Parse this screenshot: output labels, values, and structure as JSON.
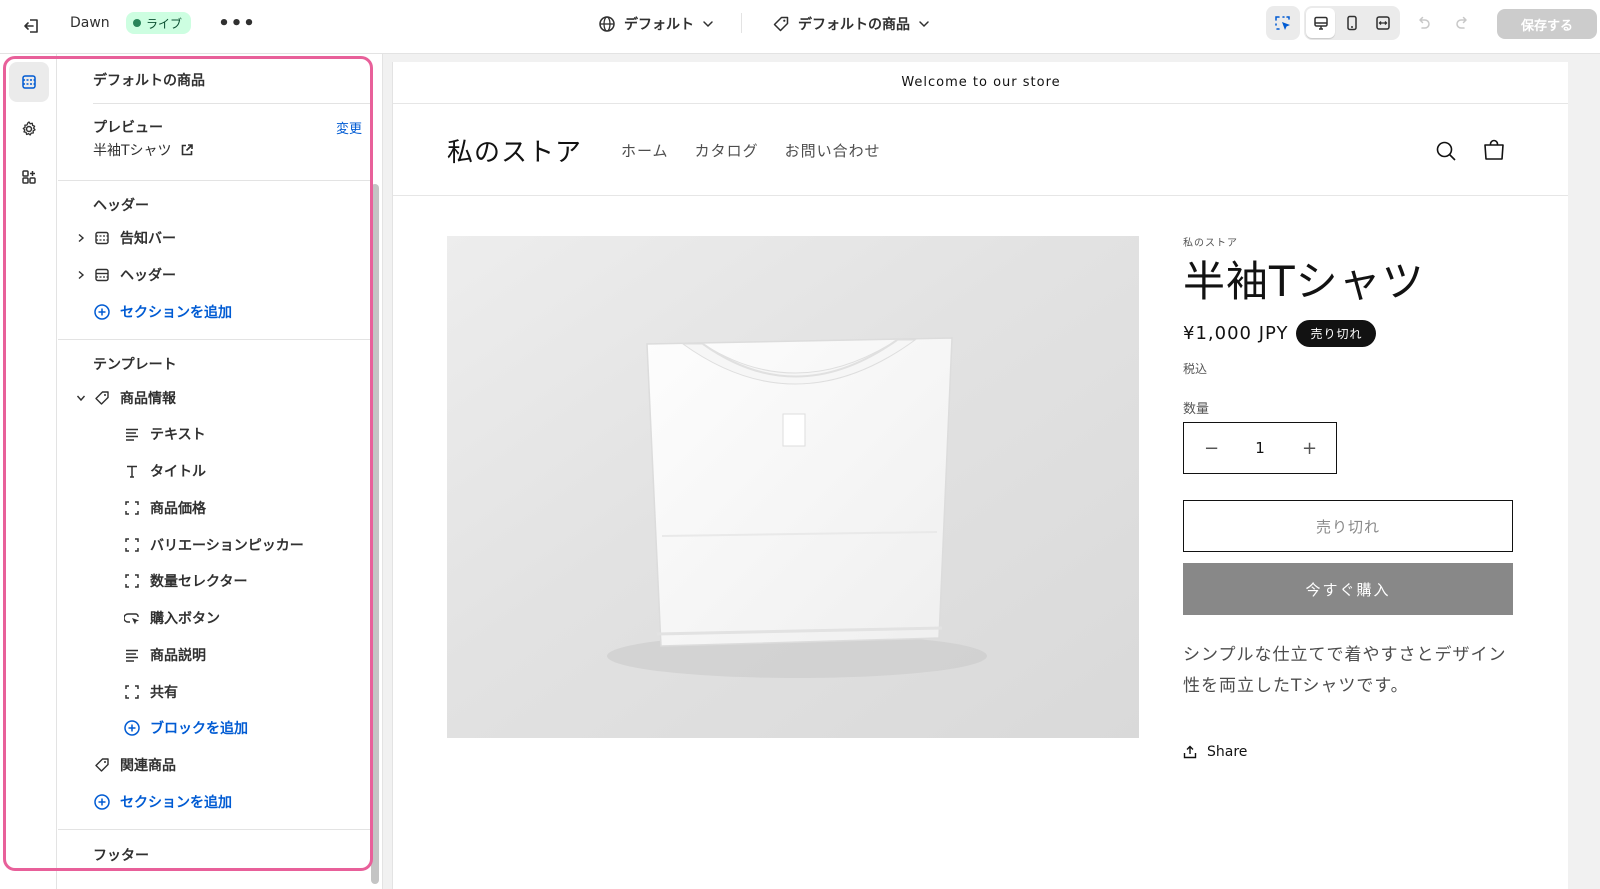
{
  "topbar": {
    "theme_name": "Dawn",
    "live_badge": "ライブ",
    "more": "•••",
    "theme_selector": "デフォルト",
    "template_selector": "デフォルトの商品",
    "save_label": "保存する"
  },
  "panel": {
    "title": "デフォルトの商品",
    "preview_label": "プレビュー",
    "change_link": "変更",
    "preview_value": "半袖Tシャツ",
    "header_group": "ヘッダー",
    "header_items": [
      "告知バー",
      "ヘッダー"
    ],
    "add_section": "セクションを追加",
    "template_group": "テンプレート",
    "product_info": "商品情報",
    "blocks": [
      "テキスト",
      "タイトル",
      "商品価格",
      "バリエーションピッカー",
      "数量セレクター",
      "購入ボタン",
      "商品説明",
      "共有"
    ],
    "add_block": "ブロックを追加",
    "related_products": "関連商品",
    "add_section_2": "セクションを追加",
    "footer_group": "フッター"
  },
  "preview": {
    "announcement": "Welcome to our store",
    "store_name": "私のストア",
    "nav": [
      "ホーム",
      "カタログ",
      "お問い合わせ"
    ],
    "vendor": "私のストア",
    "product_title": "半袖Tシャツ",
    "price": "¥1,000 JPY",
    "soldout_badge": "売り切れ",
    "tax_note": "税込",
    "quantity_label": "数量",
    "quantity_value": "1",
    "qty_minus": "−",
    "qty_plus": "+",
    "soldout_button": "売り切れ",
    "buy_now_button": "今すぐ購入",
    "description": "シンプルな仕立てで着やすさとデザイン性を両立したTシャツです。",
    "share": "Share"
  },
  "colors": {
    "link": "#005bd3",
    "highlight": "#e8609a",
    "live_bg": "#cdfee1",
    "buy_button": "#888888"
  }
}
